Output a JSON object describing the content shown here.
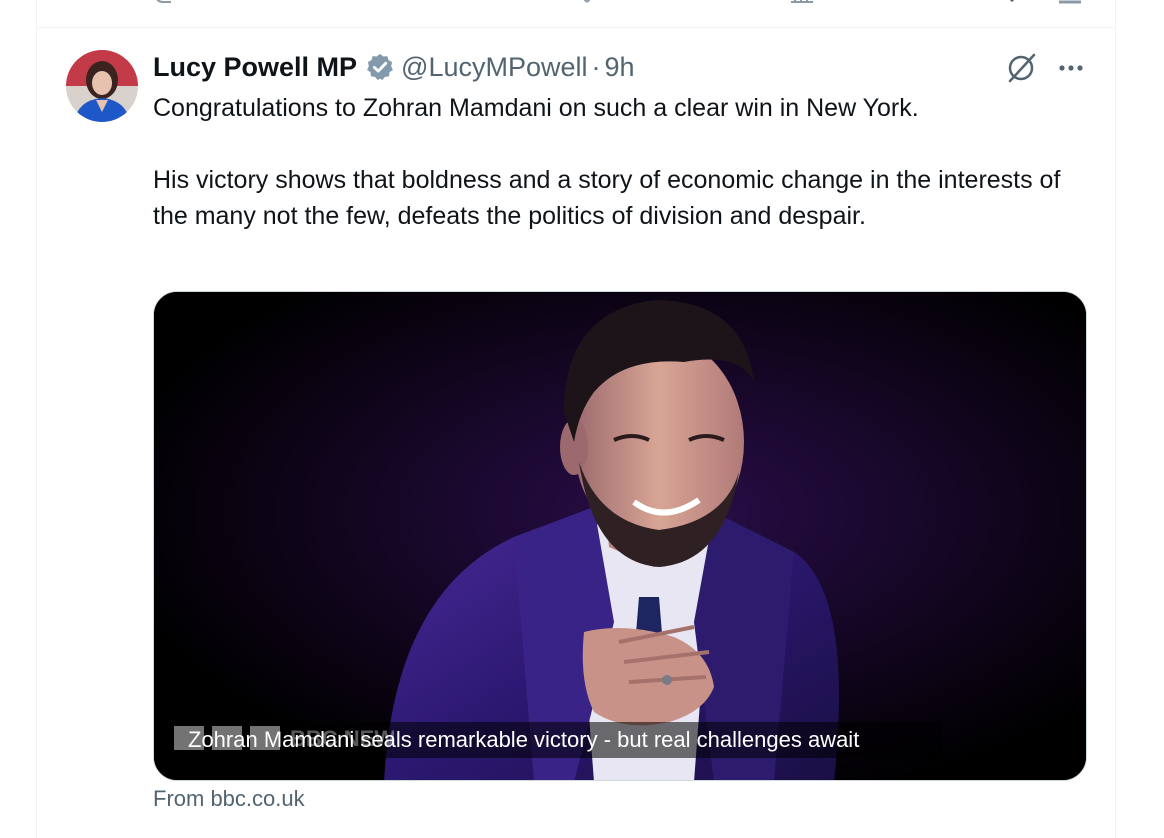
{
  "tweet": {
    "display_name": "Lucy Powell MP",
    "handle": "@LucyMPowell",
    "separator": "·",
    "time": "9h",
    "text_paragraphs": [
      "Congratulations to Zohran Mamdani on such a clear win in New York.",
      "His victory shows that boldness and a story of economic change in the interests of the many not the few, defeats the politics of division and despair."
    ],
    "verified_icon": "verified-badge-icon",
    "grok_icon": "grok-icon",
    "more_icon": "more-icon"
  },
  "card": {
    "title": "Zohran Mamdani seals remarkable victory - but real challenges await",
    "watermark": "BBC NEWS",
    "source": "From bbc.co.uk"
  },
  "colors": {
    "text_primary": "#0f1419",
    "text_secondary": "#536471",
    "verified_badge": "#829aab",
    "border": "#eff3f4"
  }
}
